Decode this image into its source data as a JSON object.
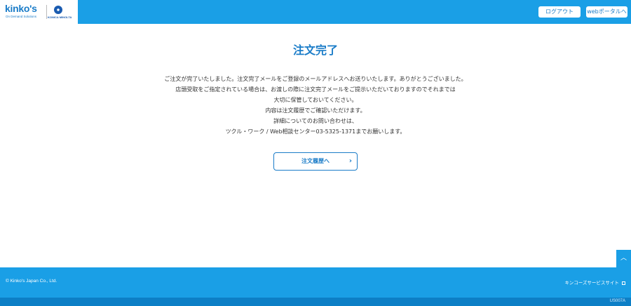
{
  "header": {
    "logo_text": "kinko's",
    "logo_subtext": "On Demand Solutions",
    "partner_logo_text": "KONICA MINOLTA",
    "logout_label": "ログアウト",
    "portal_label": "webポータルへ"
  },
  "main": {
    "title": "注文完了",
    "message_lines": [
      "ご注文が完了いたしました。注文完了メールをご登録のメールアドレスへお送りいたします。ありがとうございました。",
      "店頭受取をご指定されている場合は、お渡しの際に注文完了メールをご提示いただいておりますのでそれまでは",
      "大切に保管しておいてください。",
      "内容は注文履歴でご確認いただけます。",
      "詳細についてのお問い合わせは、",
      "ツクル・ワーク / Web相談センター03-5325-1371までお願いします。"
    ],
    "history_button_label": "注文履歴へ",
    "history_button_icon": "chevron-right-icon"
  },
  "page_top_icon": "chevron-up-icon",
  "footer": {
    "copyright": "© Kinko's Japan Co., Ltd.",
    "site_link_label": "キンコーズサービスサイト",
    "site_link_icon": "external-link-icon",
    "page_code": "US007A"
  },
  "colors": {
    "brand_blue": "#1a9fe6",
    "text_blue": "#1a7cc8",
    "bottom_bar": "#0d7fc6"
  }
}
